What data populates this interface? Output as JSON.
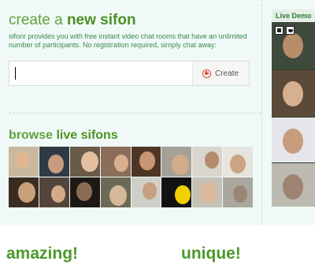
{
  "create": {
    "title_prefix": "create a",
    "title_bold": "new sifon",
    "description": "sifonr provides you with free instant video chat rooms that have an unlimited number of participants. No registration required, simply chat away:",
    "input_value": "",
    "button_label": "Create"
  },
  "browse": {
    "title_prefix": "browse",
    "title_bold": "live sifons",
    "thumbnails": [
      {
        "bg": "#c9b7a0",
        "face": "#e0b795"
      },
      {
        "bg": "#2f3a44",
        "face": "#c59c7f"
      },
      {
        "bg": "#6a5a4a",
        "face": "#e2c0a0"
      },
      {
        "bg": "#8a6e5a",
        "face": "#d9b08d"
      },
      {
        "bg": "#4e3526",
        "face": "#c79873"
      },
      {
        "bg": "#a6a197",
        "face": "#d2ab88"
      },
      {
        "bg": "#d8d6cf",
        "face": "#b58b6d"
      },
      {
        "bg": "#e6e4de",
        "face": "#caa484"
      },
      {
        "bg": "#3b2c22",
        "face": "#caa07c"
      },
      {
        "bg": "#53453b",
        "face": "#d4aa88"
      },
      {
        "bg": "#1d1a16",
        "face": "#8b6b52"
      },
      {
        "bg": "#6b6a56",
        "face": "#d6b89a"
      },
      {
        "bg": "#cfcfc9",
        "face": "#c69f7f"
      },
      {
        "bg": "#121212",
        "face": "#f0d000"
      },
      {
        "bg": "#c4c1b7",
        "face": "#dbb99a"
      },
      {
        "bg": "#aaa79f",
        "face": "#9b8675"
      }
    ]
  },
  "live_demo": {
    "label": "Live Demo",
    "frames": [
      {
        "bg": "#3e4a3c",
        "face": "#b88d6a"
      },
      {
        "bg": "#5b4a3a",
        "face": "#d7b08f"
      },
      {
        "bg": "#e4e6ea",
        "face": "#c79d7d"
      },
      {
        "bg": "#bdbab2",
        "face": "#9f8371"
      }
    ],
    "icons": [
      "layers-icon",
      "mask-icon"
    ]
  },
  "features": {
    "amazing": "amazing!",
    "unique": "unique!"
  }
}
